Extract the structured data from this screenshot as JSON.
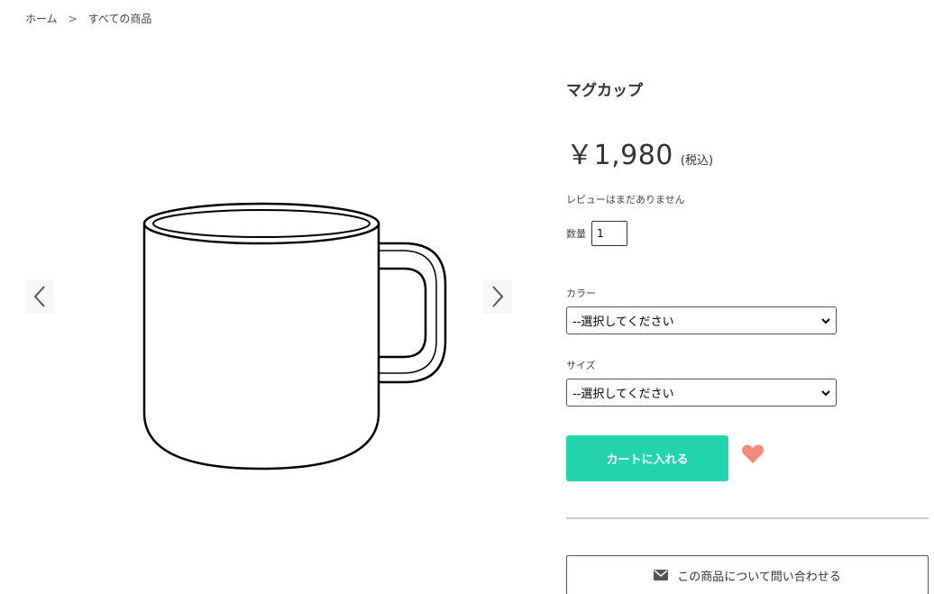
{
  "breadcrumb": {
    "home": "ホーム",
    "separator": ">",
    "current": "すべての商品"
  },
  "gallery": {
    "prev_icon": "chevron-left-icon",
    "next_icon": "chevron-right-icon",
    "image": "mug-illustration"
  },
  "product": {
    "title": "マグカップ",
    "price": "￥1,980",
    "tax_note": "(税込)",
    "review_text": "レビューはまだありません",
    "quantity_label": "数量",
    "quantity_value": "1",
    "color_label": "カラー",
    "color_selected": "--選択してください",
    "size_label": "サイズ",
    "size_selected": "--選択してください",
    "cart_button": "カートに入れる",
    "favorite_icon": "heart-icon",
    "contact_button": "この商品について問い合わせる",
    "contact_icon": "mail-icon"
  },
  "colors": {
    "accent": "#22d3ad",
    "heart": "#f48a7a",
    "text": "#333333",
    "divider": "#cccccc"
  }
}
